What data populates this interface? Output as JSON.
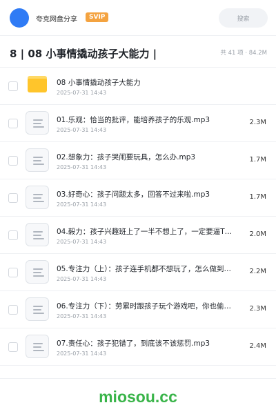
{
  "topbar": {
    "user_name": "夸克网盘分享",
    "badge": "SVIP",
    "search_placeholder": "搜索"
  },
  "header": {
    "title": "8 | 08 小事情撬动孩子大能力 |",
    "summary": "共 41 项 · 84.2M"
  },
  "files": [
    {
      "type": "folder",
      "icon": "folder-icon",
      "name": "08 小事情撬动孩子大能力",
      "date": "2025-07-31 14:43",
      "size": ""
    },
    {
      "type": "audio",
      "icon": "file-icon",
      "name": "01.乐观：恰当的批评，能培养孩子的乐观.mp3",
      "date": "2025-07-31 14:43",
      "size": "2.3M"
    },
    {
      "type": "audio",
      "icon": "file-icon",
      "name": "02.想象力：孩子哭闹要玩具，怎么办.mp3",
      "date": "2025-07-31 14:43",
      "size": "1.7M"
    },
    {
      "type": "audio",
      "icon": "file-icon",
      "name": "03.好奇心：孩子问题太多，回答不过来啦.mp3",
      "date": "2025-07-31 14:43",
      "size": "1.7M"
    },
    {
      "type": "audio",
      "icon": "file-icon",
      "name": "04.毅力：孩子兴趣班上了一半不想上了，一定要逼T…",
      "date": "2025-07-31 14:43",
      "size": "2.0M"
    },
    {
      "type": "audio",
      "icon": "file-icon",
      "name": "05.专注力（上）：孩子连手机都不想玩了，怎么做到…",
      "date": "2025-07-31 14:43",
      "size": "2.2M"
    },
    {
      "type": "audio",
      "icon": "file-icon",
      "name": "06.专注力（下）：劳累时跟孩子玩个游戏吧，你也偷…",
      "date": "2025-07-31 14:43",
      "size": "2.3M"
    },
    {
      "type": "audio",
      "icon": "file-icon",
      "name": "07.责任心：孩子犯错了，到底该不该惩罚.mp3",
      "date": "2025-07-31 14:43",
      "size": "2.4M"
    }
  ],
  "watermark": "miosou.cc",
  "colors": {
    "avatar": "#2f7bf5",
    "badge": "#f4a340",
    "folder": "#ffc52b",
    "watermark": "#39b449"
  }
}
